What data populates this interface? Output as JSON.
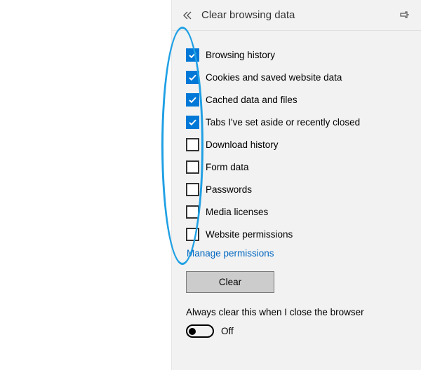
{
  "header": {
    "title": "Clear browsing data"
  },
  "options": [
    {
      "label": "Browsing history",
      "checked": true
    },
    {
      "label": "Cookies and saved website data",
      "checked": true
    },
    {
      "label": "Cached data and files",
      "checked": true
    },
    {
      "label": "Tabs I've set aside or recently closed",
      "checked": true
    },
    {
      "label": "Download history",
      "checked": false
    },
    {
      "label": "Form data",
      "checked": false
    },
    {
      "label": "Passwords",
      "checked": false
    },
    {
      "label": "Media licenses",
      "checked": false
    },
    {
      "label": "Website permissions",
      "checked": false
    }
  ],
  "manage_link": "Manage permissions",
  "clear_button": "Clear",
  "autoclear": {
    "label": "Always clear this when I close the browser",
    "state": "Off"
  },
  "icons": {
    "back": "chevrons-left-icon",
    "pin": "pin-icon",
    "check": "check-icon"
  },
  "colors": {
    "accent": "#0078d7",
    "panel_bg": "#f2f2f2",
    "link": "#0067c0",
    "button_bg": "#ccc",
    "annotation": "#1fa0e4"
  }
}
